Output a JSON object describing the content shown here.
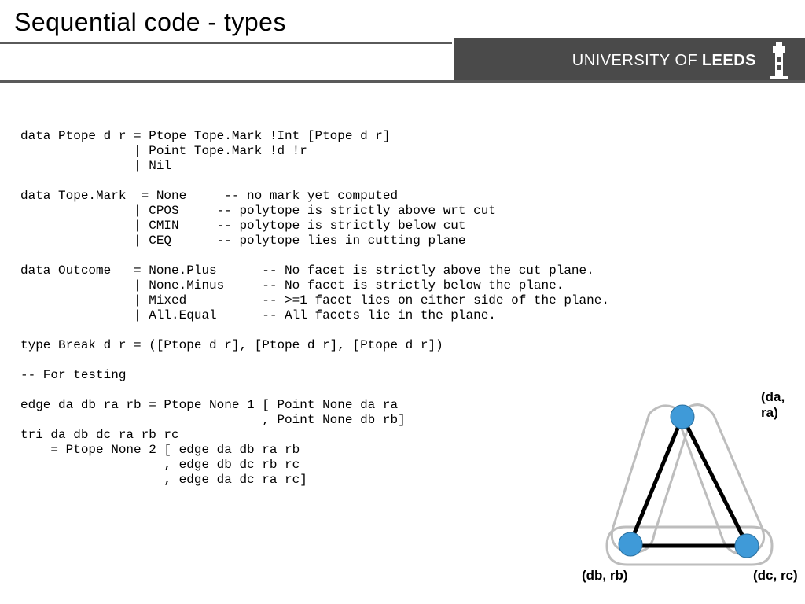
{
  "title": "Sequential code - types",
  "brand": {
    "line1": "UNIVERSITY OF",
    "line2": "LEEDS",
    "icon": "tower-icon"
  },
  "code": "data Ptope d r = Ptope Tope.Mark !Int [Ptope d r]\n               | Point Tope.Mark !d !r\n               | Nil\n\ndata Tope.Mark  = None     -- no mark yet computed\n               | CPOS     -- polytope is strictly above wrt cut\n               | CMIN     -- polytope is strictly below cut\n               | CEQ      -- polytope lies in cutting plane\n\ndata Outcome   = None.Plus      -- No facet is strictly above the cut plane.\n               | None.Minus     -- No facet is strictly below the plane.\n               | Mixed          -- >=1 facet lies on either side of the plane.\n               | All.Equal      -- All facets lie in the plane.\n\ntype Break d r = ([Ptope d r], [Ptope d r], [Ptope d r])\n\n-- For testing\n\nedge da db ra rb = Ptope None 1 [ Point None da ra\n                                , Point None db rb]\ntri da db dc ra rb rc\n    = Ptope None 2 [ edge da db ra rb\n                   , edge db dc rb rc\n                   , edge da dc ra rc]",
  "labels": {
    "a": "(da, ra)",
    "b": "(db, rb)",
    "c": "(dc, rc)"
  }
}
